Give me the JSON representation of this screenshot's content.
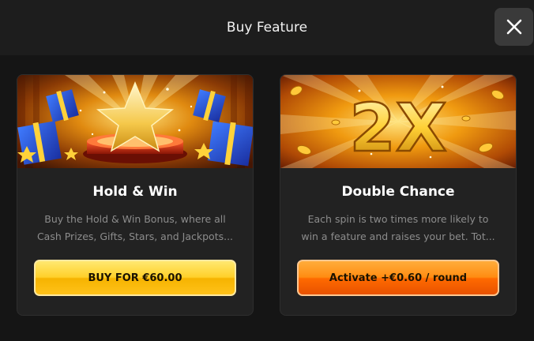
{
  "header": {
    "title": "Buy Feature",
    "close_icon": "close-icon"
  },
  "cards": [
    {
      "title": "Hold & Win",
      "description_lines": [
        "Buy the Hold & Win Bonus, where all",
        "Cash Prizes, Gifts, Stars, and Jackpots..."
      ],
      "button_label": "BUY FOR €60.00",
      "art": "gold-star-on-pedestal-with-gift-boxes",
      "button_color": "#ffd02a"
    },
    {
      "title": "Double Chance",
      "description_lines": [
        "Each spin is two times more likely to",
        "win a feature and raises your bet. Tot..."
      ],
      "button_label": "Activate +€0.60 / round",
      "art": "gold-2x-with-coins",
      "art_text": "2X",
      "button_color": "#ff7a00"
    }
  ]
}
